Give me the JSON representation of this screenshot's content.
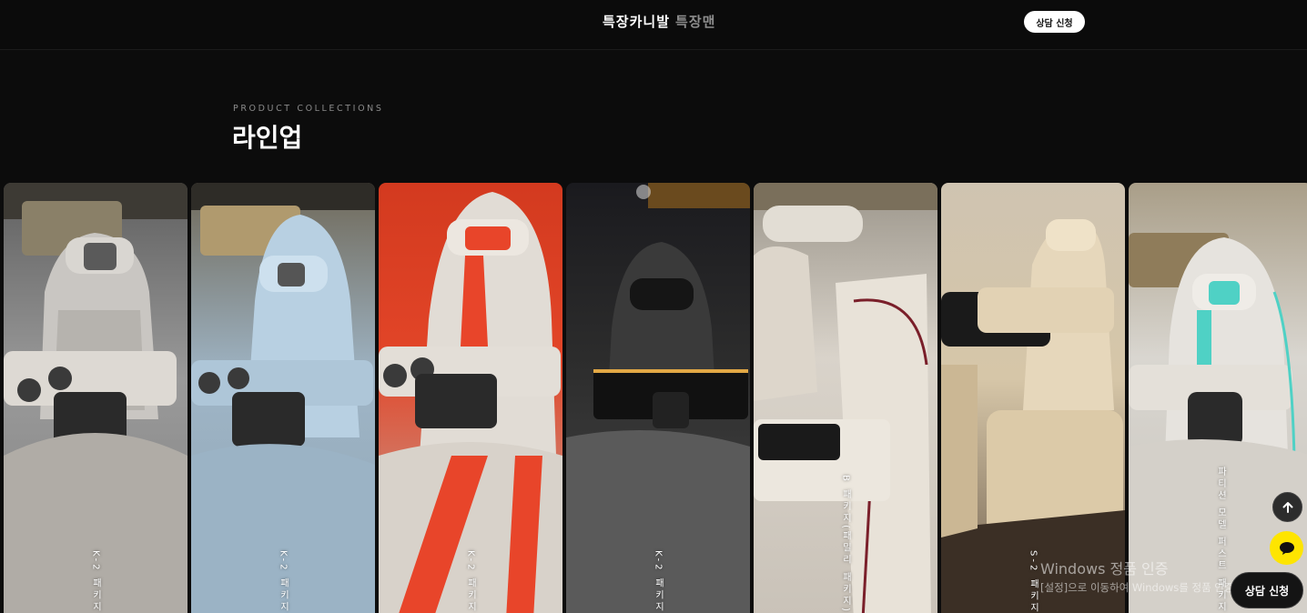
{
  "header": {
    "brand": "특장카니발",
    "sub_brand": "특장맨",
    "consult_label": "상담 신청"
  },
  "section": {
    "eyebrow": "PRODUCT COLLECTIONS",
    "title": "라인업"
  },
  "cards": [
    {
      "label": "K-2 패키지",
      "accent": "#8b8b8b"
    },
    {
      "label": "K-2 패키지",
      "accent": "#b9d1e3"
    },
    {
      "label": "K-2 패키지",
      "accent": "#e8452a"
    },
    {
      "label": "K-2 패키지",
      "accent": "#2a2a2a"
    },
    {
      "label": "B 패키지(패밀리 패키지)",
      "accent": "#7a1f2a"
    },
    {
      "label": "S-2 패키지",
      "accent": "#d9c7a6"
    },
    {
      "label": "파티션 모델 퍼스트 패키지",
      "accent": "#4fd1c5"
    }
  ],
  "watermark": {
    "title": "Windows 정품 인증",
    "subtitle": "[설정]으로 이동하여 Windows를 정품 인증합니다."
  },
  "floating": {
    "scroll_top_icon": "arrow-up-icon",
    "chat_icon": "chat-bubble-icon",
    "consult_label": "상담 신청"
  },
  "colors": {
    "background": "#0c0c0c",
    "chat_yellow": "#fee500",
    "button_white": "#ffffff"
  }
}
